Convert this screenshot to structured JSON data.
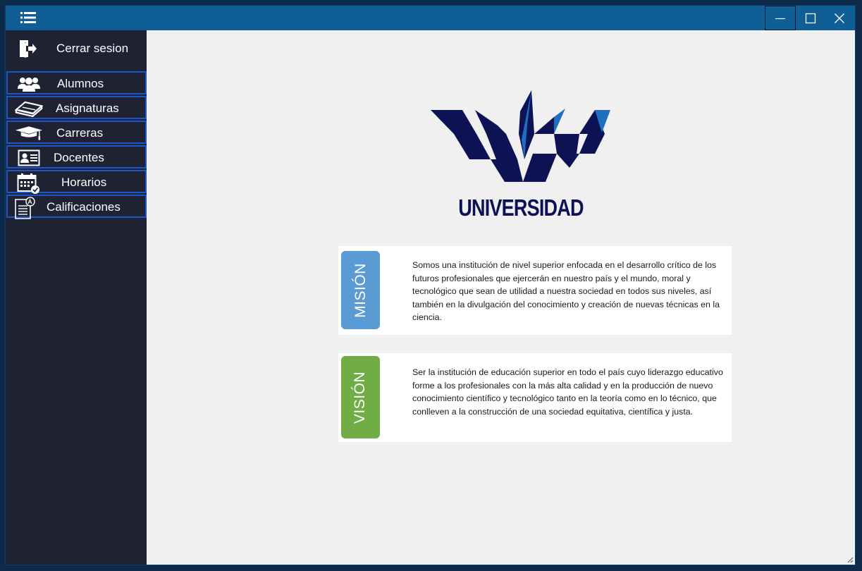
{
  "window": {
    "icons": {
      "menu": "list-icon",
      "minimize": "minimize-icon",
      "maximize": "maximize-icon",
      "close": "close-icon"
    }
  },
  "sidebar": {
    "logout": {
      "label": "Cerrar sesion",
      "icon": "logout-icon"
    },
    "items": [
      {
        "label": "Alumnos",
        "icon": "users-icon"
      },
      {
        "label": "Asignaturas",
        "icon": "books-icon"
      },
      {
        "label": "Carreras",
        "icon": "graduation-cap-icon"
      },
      {
        "label": "Docentes",
        "icon": "id-card-icon"
      },
      {
        "label": "Horarios",
        "icon": "calendar-check-icon"
      },
      {
        "label": "Calificaciones",
        "icon": "grades-document-icon"
      }
    ]
  },
  "main": {
    "logo_text": "UNIVERSIDAD",
    "mision": {
      "label": "MISIÓN",
      "text": "Somos una institución de nivel superior enfocada en el desarrollo crítico de los futuros profesionales que ejercerán en nuestro país y el mundo, moral y tecnológico que sean de utilidad a nuestra sociedad en todos sus niveles, así también en la divulgación del conocimiento y creación de nuevas técnicas en la ciencia."
    },
    "vision": {
      "label": "VISIÓN",
      "text": "Ser la institución de educación superior en todo el país cuyo liderazgo educativo forme a los profesionales con la más alta calidad y en la producción de nuevo conocimiento científico y tecnológico tanto en la teoría como en lo técnico, que conlleven a la construcción de una sociedad equitativa, científica y justa."
    }
  },
  "colors": {
    "titlebar": "#0f5e96",
    "sidebar": "#1f2233",
    "nav_border": "#1c56c8",
    "mision_tab": "#5b9bd5",
    "vision_tab": "#70ad47",
    "logo_navy": "#0d1254",
    "logo_blue": "#1e6fc0"
  }
}
